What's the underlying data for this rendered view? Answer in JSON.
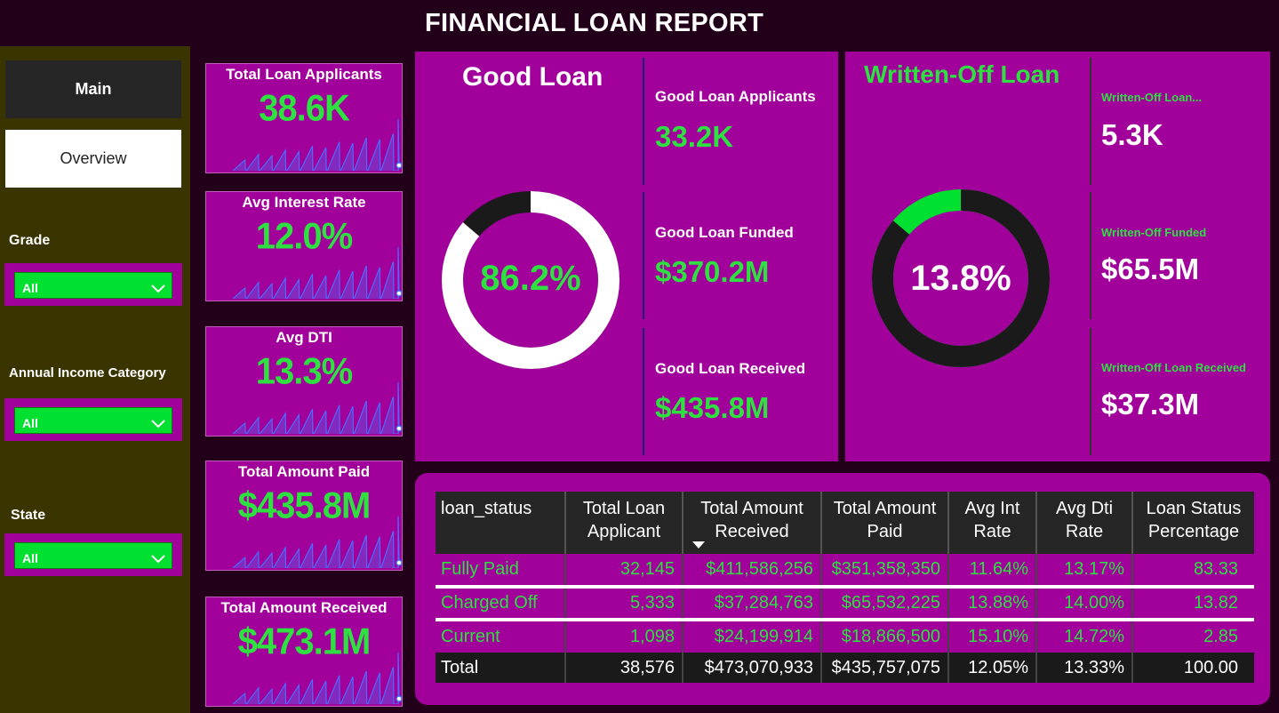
{
  "title": "FINANCIAL LOAN REPORT",
  "nav": {
    "main": "Main",
    "overview": "Overview"
  },
  "filters": [
    {
      "label": "Grade",
      "value": "All"
    },
    {
      "label": "Annual Income Category",
      "value": "All"
    },
    {
      "label": "State",
      "value": "All"
    }
  ],
  "kpis": [
    {
      "title": "Total Loan Applicants",
      "value": "38.6K"
    },
    {
      "title": "Avg Interest Rate",
      "value": "12.0%"
    },
    {
      "title": "Avg DTI",
      "value": "13.3%"
    },
    {
      "title": "Total Amount Paid",
      "value": "$435.8M"
    },
    {
      "title": "Total Amount Received",
      "value": "$473.1M"
    }
  ],
  "good_loan": {
    "title": "Good Loan",
    "percent_label": "86.2%",
    "percent": 86.2,
    "metrics": [
      {
        "label": "Good Loan Applicants",
        "value": "33.2K"
      },
      {
        "label": "Good Loan Funded",
        "value": "$370.2M"
      },
      {
        "label": "Good Loan Received",
        "value": "$435.8M"
      }
    ]
  },
  "bad_loan": {
    "title": "Written-Off Loan",
    "percent_label": "13.8%",
    "percent": 13.8,
    "metrics": [
      {
        "label": "Written-Off Loan...",
        "value": "5.3K"
      },
      {
        "label": "Written-Off Funded",
        "value": "$65.5M"
      },
      {
        "label": "Written-Off Loan Received",
        "value": "$37.3M"
      }
    ]
  },
  "colors": {
    "background": "#22001a",
    "sidebar": "#3a3500",
    "panel": "#a1009b",
    "accent_green": "#2ee040",
    "dark": "#262626"
  },
  "table": {
    "headers": [
      "loan_status",
      "Total Loan Applicant",
      "Total Amount Received",
      "Total Amount Paid",
      "Avg Int Rate",
      "Avg Dti Rate",
      "Loan Status Percentage"
    ],
    "rows": [
      [
        "Fully Paid",
        "32,145",
        "$411,586,256",
        "$351,358,350",
        "11.64%",
        "13.17%",
        "83.33"
      ],
      [
        "Charged Off",
        "5,333",
        "$37,284,763",
        "$65,532,225",
        "13.88%",
        "14.00%",
        "13.82"
      ],
      [
        "Current",
        "1,098",
        "$24,199,914",
        "$18,866,500",
        "15.10%",
        "14.72%",
        "2.85"
      ]
    ],
    "total": [
      "Total",
      "38,576",
      "$473,070,933",
      "$435,757,075",
      "12.05%",
      "13.33%",
      "100.00"
    ]
  }
}
